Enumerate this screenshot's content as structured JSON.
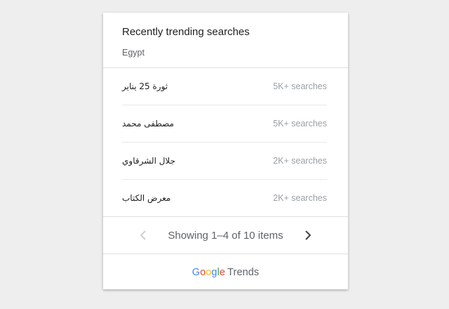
{
  "card": {
    "title": "Recently trending searches",
    "region": "Egypt"
  },
  "items": [
    {
      "term": "ثورة 25 يناير",
      "count": "5K+ searches"
    },
    {
      "term": "مصطفى محمد",
      "count": "5K+ searches"
    },
    {
      "term": "جلال الشرقاوي",
      "count": "2K+ searches"
    },
    {
      "term": "معرض الكتاب",
      "count": "2K+ searches"
    }
  ],
  "pagination": {
    "text": "Showing 1–4 of 10 items",
    "prev_icon": "chevron-left-icon",
    "next_icon": "chevron-right-icon"
  },
  "footer": {
    "logo_letters": [
      "G",
      "o",
      "o",
      "g",
      "l",
      "e"
    ],
    "logo_colors": [
      "#4285F4",
      "#EA4335",
      "#FBBC05",
      "#4285F4",
      "#34A853",
      "#EA4335"
    ],
    "product": "Trends"
  }
}
